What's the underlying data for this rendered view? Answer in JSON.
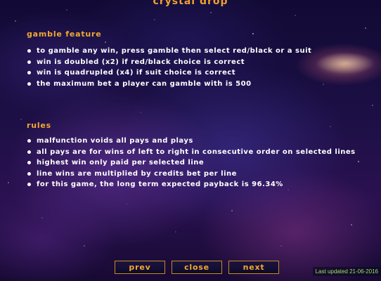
{
  "game_title": "crystal drop",
  "sections": [
    {
      "heading": "gamble feature",
      "items": [
        "To gamble any win, press gamble then select red/black or a suit",
        "Win is doubled (x2) if red/black choice is correct",
        "Win is quadrupled (x4) if suit choice is correct",
        "The maximum bet a player can gamble with is 500"
      ]
    },
    {
      "heading": "rules",
      "items": [
        "Malfunction voids all pays and plays",
        "All pays are for wins of left to right in consecutive order on selected lines",
        "Highest win only paid per selected line",
        "Line wins are multiplied by credits bet per line",
        "For this game, the long term expected payback is 96.34%"
      ]
    }
  ],
  "navigation": {
    "prev_label": "prev",
    "close_label": "close",
    "next_label": "next"
  },
  "last_updated": "Last updated 21-06-2016",
  "colors": {
    "accent": "#f2a832",
    "text": "#ffffff",
    "last_updated": "#9fe06a",
    "background": "#1c0f45"
  }
}
